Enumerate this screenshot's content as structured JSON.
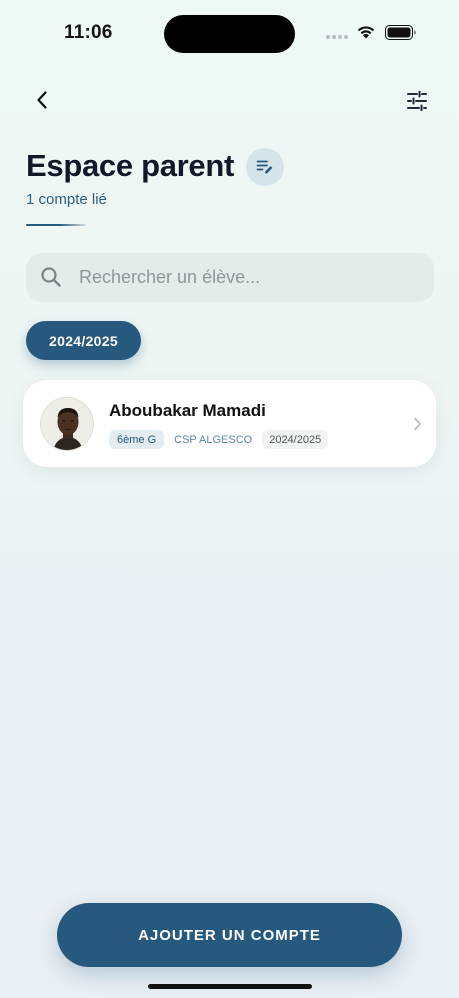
{
  "status_bar": {
    "time": "11:06"
  },
  "header": {
    "title": "Espace parent",
    "subtitle": "1 compte lié"
  },
  "search": {
    "placeholder": "Rechercher un élève...",
    "value": ""
  },
  "year_filter": {
    "selected": "2024/2025"
  },
  "students": [
    {
      "name": "Aboubakar Mamadi",
      "class": "6ème G",
      "school": "CSP ALGESCO",
      "year": "2024/2025"
    }
  ],
  "actions": {
    "add_account_label": "AJOUTER UN COMPTE"
  },
  "colors": {
    "primary": "#27587e",
    "background": "#eef6f4",
    "card": "#ffffff"
  },
  "icons": {
    "back": "chevron-left-icon",
    "filter": "sliders-icon",
    "edit_list": "list-edit-icon",
    "search": "search-icon",
    "card_chevron": "chevron-right-icon"
  }
}
